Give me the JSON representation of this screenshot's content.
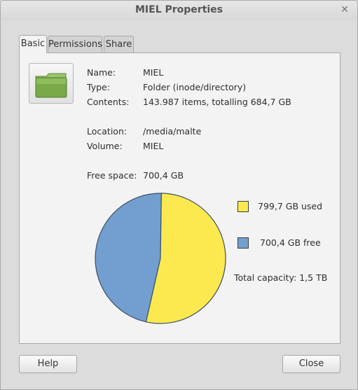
{
  "window": {
    "title": "MIEL Properties",
    "close_icon": "close-icon"
  },
  "tabs": [
    {
      "label": "Basic",
      "active": true
    },
    {
      "label": "Permissions",
      "active": false
    },
    {
      "label": "Share",
      "active": false
    }
  ],
  "info": {
    "name_label": "Name:",
    "name_value": "MIEL",
    "type_label": "Type:",
    "type_value": "Folder (inode/directory)",
    "contents_label": "Contents:",
    "contents_value": "143.987 items, totalling 684,7 GB",
    "location_label": "Location:",
    "location_value": "/media/malte",
    "volume_label": "Volume:",
    "volume_value": "MIEL",
    "free_label": "Free space:",
    "free_value": "700,4 GB"
  },
  "usage": {
    "used_label": "799,7 GB used",
    "free_label": "700,4 GB free",
    "capacity_label": "Total capacity: 1,5 TB",
    "used_gb": 799.7,
    "free_gb": 700.4,
    "used_color": "#fce94f",
    "free_color": "#729fcf"
  },
  "buttons": {
    "help": "Help",
    "close": "Close"
  }
}
